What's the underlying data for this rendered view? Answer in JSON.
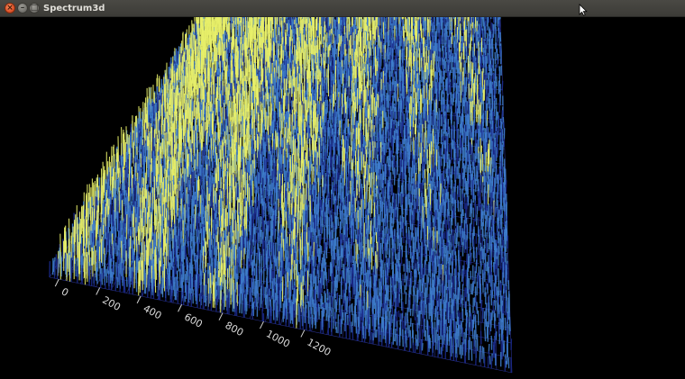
{
  "window": {
    "title": "Spectrum3d",
    "controls": {
      "close_icon": "close-icon",
      "minimize_icon": "minimize-icon",
      "maximize_icon": "maximize-icon"
    }
  },
  "plot": {
    "type": "3d-spectrogram",
    "x_axis_ticks": [
      "0",
      "200",
      "400",
      "600",
      "800",
      "1000",
      "1200"
    ],
    "colors": {
      "background": "#000000",
      "grid": "#3a46c8",
      "low": "#1a2a8c",
      "mid": "#3f7fd0",
      "high": "#e8f06a"
    }
  }
}
